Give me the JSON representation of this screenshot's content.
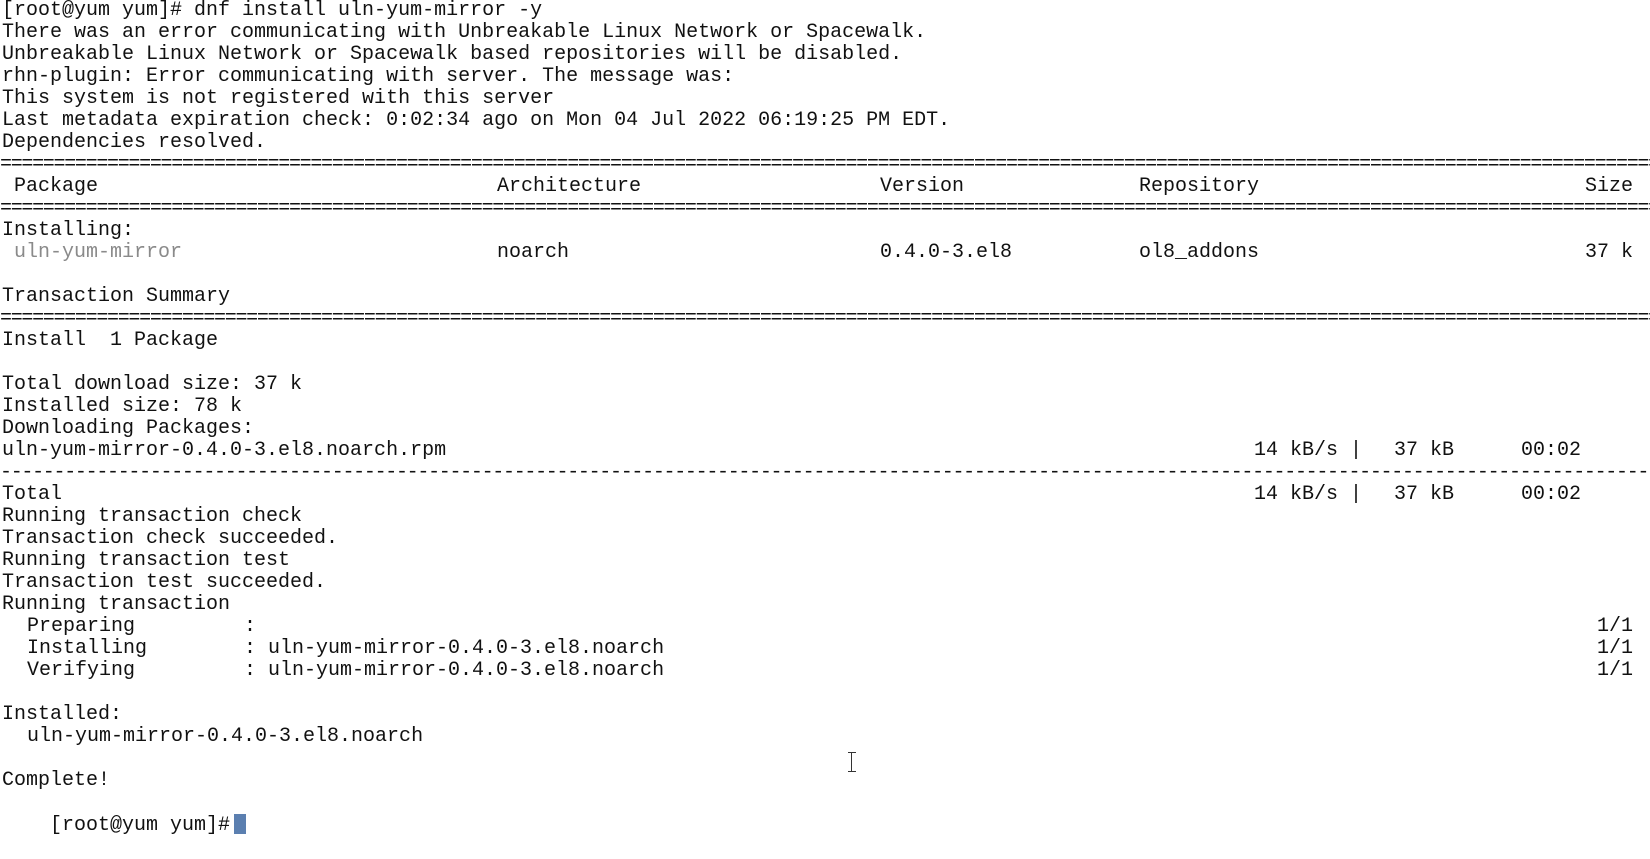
{
  "terminal": {
    "prompt_command": "[root@yum yum]# dnf install uln-yum-mirror -y",
    "header_lines": [
      "There was an error communicating with Unbreakable Linux Network or Spacewalk.",
      "Unbreakable Linux Network or Spacewalk based repositories will be disabled.",
      "rhn-plugin: Error communicating with server. The message was:",
      "This system is not registered with this server",
      "Last metadata expiration check: 0:02:34 ago on Mon 04 Jul 2022 06:19:25 PM EDT.",
      "Dependencies resolved."
    ],
    "double_rule": "======================================================================================================================================================================================================================================",
    "single_rule": "------------------------------------------------------------------------------------------------------------------------------------------------------------------------------------------------------------------------------",
    "table": {
      "headers": [
        "Package",
        "Architecture",
        "Version",
        "Repository",
        "Size"
      ],
      "section_label": "Installing:",
      "row": {
        "package": "uln-yum-mirror",
        "arch": "noarch",
        "version": "0.4.0-3.el8",
        "repository": "ol8_addons",
        "size": "37 k"
      }
    },
    "summary": {
      "title": "Transaction Summary",
      "install_line": "Install  1 Package",
      "total_download": "Total download size: 37 k",
      "installed_size": "Installed size: 78 k",
      "downloading": "Downloading Packages:"
    },
    "download": {
      "file": "uln-yum-mirror-0.4.0-3.el8.noarch.rpm",
      "speed": "14 kB/s |",
      "size": "37 kB",
      "time": "00:02"
    },
    "total": {
      "label": "Total",
      "speed": "14 kB/s |",
      "size": "37 kB",
      "time": "00:02"
    },
    "transaction_lines": [
      "Running transaction check",
      "Transaction check succeeded.",
      "Running transaction test",
      "Transaction test succeeded.",
      "Running transaction"
    ],
    "steps": [
      {
        "action": "Preparing",
        "colon": ":",
        "target": "",
        "count": "1/1"
      },
      {
        "action": "Installing",
        "colon": ":",
        "target": "uln-yum-mirror-0.4.0-3.el8.noarch",
        "count": "1/1"
      },
      {
        "action": "Verifying",
        "colon": ":",
        "target": "uln-yum-mirror-0.4.0-3.el8.noarch",
        "count": "1/1"
      }
    ],
    "installed_label": "Installed:",
    "installed_package": "uln-yum-mirror-0.4.0-3.el8.noarch",
    "complete": "Complete!",
    "final_prompt": "[root@yum yum]#"
  }
}
